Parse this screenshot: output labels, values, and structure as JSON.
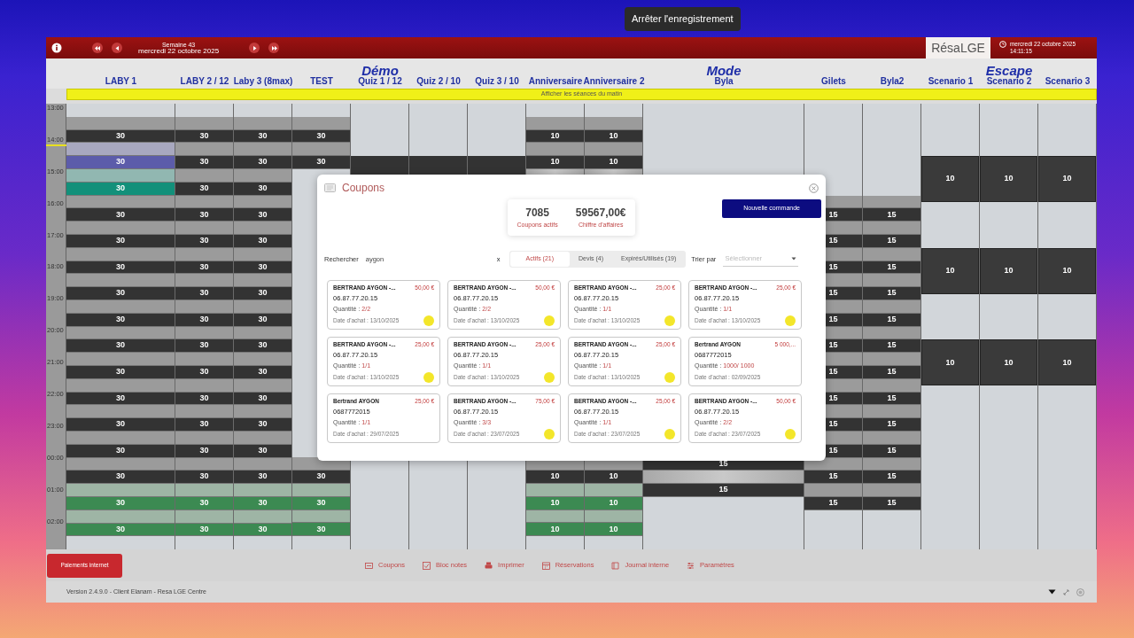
{
  "recording_tooltip": "Arrêter l'enregistrement",
  "header": {
    "week": "Semaine 43",
    "date": "mercredi 22 octobre 2025",
    "logo": "RésaLGE",
    "clock_date": "mercredi 22 octobre 2025",
    "clock_time": "14:11:15"
  },
  "morning_bar": "Afficher les séances du matin",
  "hours": [
    "13:00",
    "14:00",
    "15:00",
    "16:00",
    "17:00",
    "18:00",
    "19:00",
    "20:00",
    "21:00",
    "22:00",
    "23:00",
    "00:00",
    "01:00",
    "02:00"
  ],
  "columns": [
    {
      "label": "LABY 1",
      "top": [
        {
          "kind": "gap"
        },
        {
          "kind": "session",
          "count": "30",
          "color": "#333333"
        },
        {
          "kind": "session",
          "count": "30",
          "color": "#5c5caa"
        },
        {
          "kind": "session",
          "count": "30",
          "color": "#12907a"
        },
        {
          "kind": "session",
          "count": "30",
          "color": "#333333"
        },
        {
          "kind": "session",
          "count": "30",
          "color": "#333333"
        },
        {
          "kind": "session",
          "count": "30",
          "color": "#333333"
        },
        {
          "kind": "session",
          "count": "30",
          "color": "#333333"
        },
        {
          "kind": "session",
          "count": "30",
          "color": "#333333"
        },
        {
          "kind": "session",
          "count": "30",
          "color": "#333333"
        },
        {
          "kind": "session",
          "count": "30",
          "color": "#333333"
        },
        {
          "kind": "session",
          "count": "30",
          "color": "#333333"
        },
        {
          "kind": "session",
          "count": "30",
          "color": "#333333"
        },
        {
          "kind": "session",
          "count": "30",
          "color": "#333333"
        },
        {
          "kind": "session",
          "count": "30",
          "color": "#333333"
        },
        {
          "kind": "session",
          "count": "30",
          "color": "#3c8a52"
        },
        {
          "kind": "session",
          "count": "30",
          "color": "#3c8a52"
        }
      ]
    },
    {
      "label": "LABY 2 / 12",
      "top": [
        {
          "kind": "gap"
        },
        {
          "kind": "session",
          "count": "30",
          "color": "#333333"
        },
        {
          "kind": "session",
          "count": "30",
          "color": "#333333"
        },
        {
          "kind": "session",
          "count": "30",
          "color": "#333333"
        },
        {
          "kind": "session",
          "count": "30",
          "color": "#333333"
        },
        {
          "kind": "session",
          "count": "30",
          "color": "#333333"
        },
        {
          "kind": "session",
          "count": "30",
          "color": "#333333"
        },
        {
          "kind": "session",
          "count": "30",
          "color": "#333333"
        },
        {
          "kind": "session",
          "count": "30",
          "color": "#333333"
        },
        {
          "kind": "session",
          "count": "30",
          "color": "#333333"
        },
        {
          "kind": "session",
          "count": "30",
          "color": "#333333"
        },
        {
          "kind": "session",
          "count": "30",
          "color": "#333333"
        },
        {
          "kind": "session",
          "count": "30",
          "color": "#333333"
        },
        {
          "kind": "session",
          "count": "30",
          "color": "#333333"
        },
        {
          "kind": "session",
          "count": "30",
          "color": "#333333"
        },
        {
          "kind": "session",
          "count": "30",
          "color": "#3c8a52"
        },
        {
          "kind": "session",
          "count": "30",
          "color": "#3c8a52"
        }
      ]
    },
    {
      "label": "Laby 3 (8max)",
      "top": [
        {
          "kind": "gap"
        },
        {
          "kind": "session",
          "count": "30",
          "color": "#333333"
        },
        {
          "kind": "session",
          "count": "30",
          "color": "#333333"
        },
        {
          "kind": "session",
          "count": "30",
          "color": "#333333"
        },
        {
          "kind": "session",
          "count": "30",
          "color": "#333333"
        },
        {
          "kind": "session",
          "count": "30",
          "color": "#333333"
        },
        {
          "kind": "session",
          "count": "30",
          "color": "#333333"
        },
        {
          "kind": "session",
          "count": "30",
          "color": "#333333"
        },
        {
          "kind": "session",
          "count": "30",
          "color": "#333333"
        },
        {
          "kind": "session",
          "count": "30",
          "color": "#333333"
        },
        {
          "kind": "session",
          "count": "30",
          "color": "#333333"
        },
        {
          "kind": "session",
          "count": "30",
          "color": "#333333"
        },
        {
          "kind": "session",
          "count": "30",
          "color": "#333333"
        },
        {
          "kind": "session",
          "count": "30",
          "color": "#333333"
        },
        {
          "kind": "session",
          "count": "30",
          "color": "#333333"
        },
        {
          "kind": "session",
          "count": "30",
          "color": "#3c8a52"
        },
        {
          "kind": "session",
          "count": "30",
          "color": "#3c8a52"
        }
      ]
    },
    {
      "label": "TEST",
      "top": [
        {
          "kind": "gap"
        },
        {
          "kind": "session",
          "count": "30",
          "color": "#333333"
        },
        {
          "kind": "session",
          "count": "30",
          "color": "#333333"
        }
      ],
      "bottom": [
        {
          "kind": "session",
          "count": "30",
          "color": "#333333"
        },
        {
          "kind": "session",
          "count": "30",
          "color": "#3c8a52"
        },
        {
          "kind": "session",
          "count": "30",
          "color": "#3c8a52"
        },
        {
          "kind": "gap"
        }
      ]
    },
    {
      "label": "Quiz 1 / 12",
      "group": "Démo",
      "top": [
        {
          "kind": "gap"
        },
        {
          "kind": "gap"
        },
        {
          "kind": "gap"
        },
        {
          "kind": "gap"
        },
        {
          "kind": "closed"
        }
      ]
    },
    {
      "label": "Quiz 2 / 10",
      "top": [
        {
          "kind": "gap"
        },
        {
          "kind": "gap"
        },
        {
          "kind": "gap"
        },
        {
          "kind": "gap"
        },
        {
          "kind": "closed"
        }
      ]
    },
    {
      "label": "Quiz 3 / 10",
      "top": [
        {
          "kind": "gap"
        },
        {
          "kind": "gap"
        },
        {
          "kind": "gap"
        },
        {
          "kind": "gap"
        },
        {
          "kind": "closed"
        }
      ]
    },
    {
      "label": "Anniversaire",
      "top": [
        {
          "kind": "gap"
        },
        {
          "kind": "session",
          "count": "10",
          "color": "#333333"
        },
        {
          "kind": "session",
          "count": "10",
          "color": "#333333"
        },
        {
          "kind": "time"
        }
      ],
      "bottom": [
        {
          "kind": "session",
          "count": "10",
          "color": "#333333"
        },
        {
          "kind": "session",
          "count": "10",
          "color": "#3c8a52"
        },
        {
          "kind": "session",
          "count": "10",
          "color": "#3c8a52"
        },
        {
          "kind": "gap"
        }
      ]
    },
    {
      "label": "Anniversaire 2",
      "top": [
        {
          "kind": "gap"
        },
        {
          "kind": "session",
          "count": "10",
          "color": "#333333"
        },
        {
          "kind": "session",
          "count": "10",
          "color": "#333333"
        },
        {
          "kind": "time"
        }
      ],
      "bottom": [
        {
          "kind": "session",
          "count": "10",
          "color": "#333333"
        },
        {
          "kind": "session",
          "count": "10",
          "color": "#3c8a52"
        },
        {
          "kind": "session",
          "count": "10",
          "color": "#3c8a52"
        },
        {
          "kind": "gap"
        }
      ]
    },
    {
      "label": "Byla",
      "group": "Mode",
      "bottom": [
        {
          "kind": "count",
          "count": "15"
        },
        {
          "kind": "time"
        },
        {
          "kind": "count",
          "count": "15"
        },
        {
          "kind": "gap"
        },
        {
          "kind": "gap"
        },
        {
          "kind": "gap"
        },
        {
          "kind": "gap"
        }
      ]
    },
    {
      "label": "Gilets",
      "top": [
        {
          "kind": "gap"
        },
        {
          "kind": "gap"
        },
        {
          "kind": "gap"
        },
        {
          "kind": "gap"
        },
        {
          "kind": "gap"
        },
        {
          "kind": "gap"
        },
        {
          "kind": "gap"
        },
        {
          "kind": "session",
          "count": "15",
          "color": "#333333"
        },
        {
          "kind": "session",
          "count": "15",
          "color": "#333333"
        },
        {
          "kind": "session",
          "count": "15",
          "color": "#333333"
        },
        {
          "kind": "session",
          "count": "15",
          "color": "#333333"
        },
        {
          "kind": "session",
          "count": "15",
          "color": "#333333"
        },
        {
          "kind": "session",
          "count": "15",
          "color": "#333333"
        },
        {
          "kind": "session",
          "count": "15",
          "color": "#333333"
        },
        {
          "kind": "session",
          "count": "15",
          "color": "#333333"
        },
        {
          "kind": "session",
          "count": "15",
          "color": "#333333"
        },
        {
          "kind": "session",
          "count": "15",
          "color": "#333333"
        },
        {
          "kind": "session",
          "count": "15",
          "color": "#333333"
        },
        {
          "kind": "session",
          "count": "15",
          "color": "#333333"
        }
      ]
    },
    {
      "label": "Byla2",
      "top": [
        {
          "kind": "gap"
        },
        {
          "kind": "gap"
        },
        {
          "kind": "gap"
        },
        {
          "kind": "gap"
        },
        {
          "kind": "gap"
        },
        {
          "kind": "gap"
        },
        {
          "kind": "gap"
        },
        {
          "kind": "session",
          "count": "15",
          "color": "#333333"
        },
        {
          "kind": "session",
          "count": "15",
          "color": "#333333"
        },
        {
          "kind": "session",
          "count": "15",
          "color": "#333333"
        },
        {
          "kind": "session",
          "count": "15",
          "color": "#333333"
        },
        {
          "kind": "session",
          "count": "15",
          "color": "#333333"
        },
        {
          "kind": "session",
          "count": "15",
          "color": "#333333"
        },
        {
          "kind": "session",
          "count": "15",
          "color": "#333333"
        },
        {
          "kind": "session",
          "count": "15",
          "color": "#333333"
        },
        {
          "kind": "session",
          "count": "15",
          "color": "#333333"
        },
        {
          "kind": "session",
          "count": "15",
          "color": "#333333"
        },
        {
          "kind": "session",
          "count": "15",
          "color": "#333333"
        },
        {
          "kind": "session",
          "count": "15",
          "color": "#333333"
        }
      ]
    },
    {
      "label": "Scenario 1",
      "top": [
        {
          "kind": "gap"
        },
        {
          "kind": "gap"
        },
        {
          "kind": "gap"
        },
        {
          "kind": "gap"
        },
        {
          "kind": "block",
          "count": "10"
        },
        {
          "kind": "pause"
        },
        {
          "kind": "block",
          "count": "10"
        },
        {
          "kind": "pause"
        },
        {
          "kind": "block",
          "count": "10"
        }
      ]
    },
    {
      "label": "Scenario 2",
      "group": "Escape",
      "top": [
        {
          "kind": "gap"
        },
        {
          "kind": "gap"
        },
        {
          "kind": "gap"
        },
        {
          "kind": "gap"
        },
        {
          "kind": "block",
          "count": "10"
        },
        {
          "kind": "pause"
        },
        {
          "kind": "block",
          "count": "10"
        },
        {
          "kind": "pause"
        },
        {
          "kind": "block",
          "count": "10"
        }
      ]
    },
    {
      "label": "Scenario 3",
      "top": [
        {
          "kind": "gap"
        },
        {
          "kind": "gap"
        },
        {
          "kind": "gap"
        },
        {
          "kind": "gap"
        },
        {
          "kind": "block",
          "count": "10"
        },
        {
          "kind": "pause"
        },
        {
          "kind": "block",
          "count": "10"
        },
        {
          "kind": "pause"
        },
        {
          "kind": "block",
          "count": "10"
        }
      ]
    }
  ],
  "coupons_dialog": {
    "title": "Coupons",
    "stats": [
      {
        "value": "7085",
        "label": "Coupons actifs"
      },
      {
        "value": "59567,00€",
        "label": "Chiffre d'affaires"
      }
    ],
    "new_button": "Nouvelle commande",
    "search": {
      "label": "Rechercher",
      "value": "aygon",
      "clear": "x"
    },
    "tabs": [
      {
        "label": "Actifs (21)",
        "selected": true
      },
      {
        "label": "Devis (4)",
        "selected": false
      },
      {
        "label": "Expirés/Utilisés (19)",
        "selected": false
      }
    ],
    "sort": {
      "label": "Trier par",
      "placeholder": "Sélectionner"
    },
    "coupons": [
      {
        "name": "BERTRAND AYGON -...",
        "price": "50,00 €",
        "phone": "06.87.77.20.15",
        "quantity_label": "Quantité :",
        "quantity": "2/2",
        "date": "Date d'achat : 13/10/2025",
        "marked": true
      },
      {
        "name": "BERTRAND AYGON -...",
        "price": "50,00 €",
        "phone": "06.87.77.20.15",
        "quantity_label": "Quantité :",
        "quantity": "2/2",
        "date": "Date d'achat : 13/10/2025",
        "marked": true
      },
      {
        "name": "BERTRAND AYGON -...",
        "price": "25,00 €",
        "phone": "06.87.77.20.15",
        "quantity_label": "Quantité :",
        "quantity": "1/1",
        "date": "Date d'achat : 13/10/2025",
        "marked": true
      },
      {
        "name": "BERTRAND AYGON -...",
        "price": "25,00 €",
        "phone": "06.87.77.20.15",
        "quantity_label": "Quantité :",
        "quantity": "1/1",
        "date": "Date d'achat : 13/10/2025",
        "marked": true
      },
      {
        "name": "BERTRAND AYGON -...",
        "price": "25,00 €",
        "phone": "06.87.77.20.15",
        "quantity_label": "Quantité :",
        "quantity": "1/1",
        "date": "Date d'achat : 13/10/2025",
        "marked": true
      },
      {
        "name": "BERTRAND AYGON -...",
        "price": "25,00 €",
        "phone": "06.87.77.20.15",
        "quantity_label": "Quantité :",
        "quantity": "1/1",
        "date": "Date d'achat : 13/10/2025",
        "marked": true
      },
      {
        "name": "BERTRAND AYGON -...",
        "price": "25,00 €",
        "phone": "06.87.77.20.15",
        "quantity_label": "Quantité :",
        "quantity": "1/1",
        "date": "Date d'achat : 13/10/2025",
        "marked": true
      },
      {
        "name": "Bertrand AYGON",
        "price": "5 000,...",
        "phone": "0687772015",
        "quantity_label": "Quantité :",
        "quantity": "1000/ 1000",
        "date": "Date d'achat : 02/09/2025",
        "marked": false
      },
      {
        "name": "Bertrand AYGON",
        "price": "25,00 €",
        "phone": "0687772015",
        "quantity_label": "Quantité :",
        "quantity": "1/1",
        "date": "Date d'achat : 29/07/2025",
        "marked": false
      },
      {
        "name": "BERTRAND AYGON -...",
        "price": "75,00 €",
        "phone": "06.87.77.20.15",
        "quantity_label": "Quantité :",
        "quantity": "3/3",
        "date": "Date d'achat : 23/07/2025",
        "marked": true
      },
      {
        "name": "BERTRAND AYGON -...",
        "price": "25,00 €",
        "phone": "06.87.77.20.15",
        "quantity_label": "Quantité :",
        "quantity": "1/1",
        "date": "Date d'achat : 23/07/2025",
        "marked": true
      },
      {
        "name": "BERTRAND AYGON -...",
        "price": "50,00 €",
        "phone": "06.87.77.20.15",
        "quantity_label": "Quantité :",
        "quantity": "2/2",
        "date": "Date d'achat : 23/07/2025",
        "marked": true
      }
    ]
  },
  "toolbar": {
    "payments_button": "Paiements internet",
    "links": [
      {
        "label": "Coupons"
      },
      {
        "label": "Bloc notes"
      },
      {
        "label": "Imprimer"
      },
      {
        "label": "Réservations"
      },
      {
        "label": "Journal interne"
      },
      {
        "label": "Paramètres"
      }
    ]
  },
  "version": "Version 2.4.9.0 - Client Elanam - Resa LGE Centre"
}
